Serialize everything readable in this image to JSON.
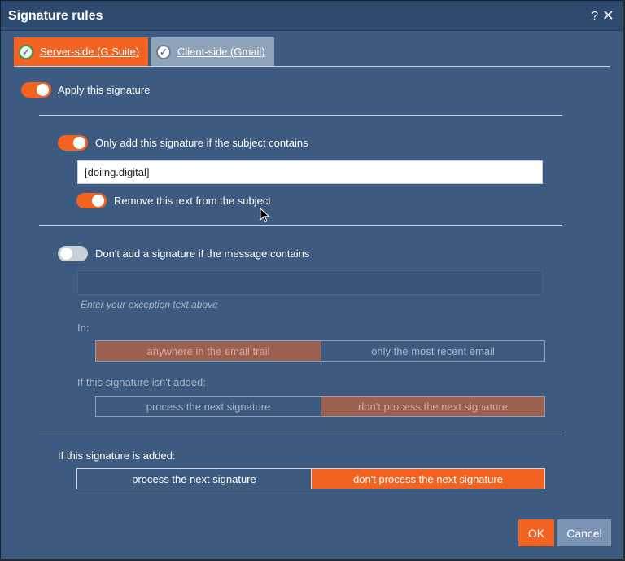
{
  "dialog": {
    "title": "Signature rules",
    "help_symbol": "?",
    "close_symbol": "✕"
  },
  "tabs": [
    {
      "label": "Server-side (G Suite)",
      "icon": "check-circle-icon",
      "active": true
    },
    {
      "label": "Client-side (Gmail)",
      "icon": "check-circle-icon",
      "active": false
    }
  ],
  "apply": {
    "label": "Apply this signature",
    "enabled": true
  },
  "subject_rule": {
    "label": "Only add this signature if the subject contains",
    "enabled": true,
    "value": "[doiing.digital]",
    "remove_label": "Remove this text from the subject",
    "remove_enabled": true
  },
  "exception_rule": {
    "label": "Don't add a signature if the message contains",
    "enabled": false,
    "value": "",
    "hint": "Enter your exception text above",
    "in_label": "In:",
    "in_options": [
      "anywhere in the email trail",
      "only the most recent email"
    ],
    "in_selected": 0,
    "not_added_label": "If this signature isn't added:",
    "not_added_options": [
      "process the next signature",
      "don't process the next signature"
    ],
    "not_added_selected": 1
  },
  "added_rule": {
    "label": "If this signature is added:",
    "options": [
      "process the next signature",
      "don't process the next signature"
    ],
    "selected": 1
  },
  "buttons": {
    "ok": "OK",
    "cancel": "Cancel"
  },
  "colors": {
    "accent": "#f26322",
    "background": "#3d5a80",
    "titlebar": "#2e4a6f"
  }
}
